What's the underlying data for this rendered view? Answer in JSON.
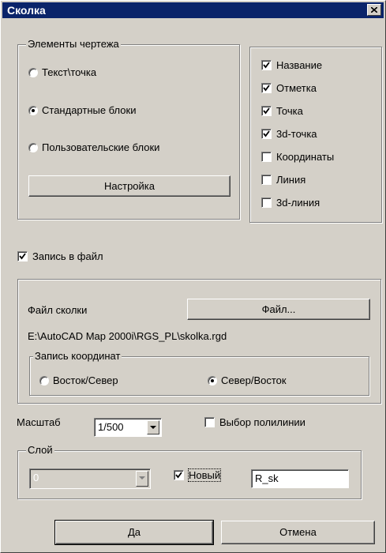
{
  "window": {
    "title": "Сколка"
  },
  "elements_group": {
    "legend": "Элементы чертежа",
    "radios": [
      {
        "label": "Текст\\точка",
        "selected": false
      },
      {
        "label": "Стандартные блоки",
        "selected": true
      },
      {
        "label": "Пользовательские блоки",
        "selected": false
      }
    ],
    "settings_button": "Настройка"
  },
  "attributes": [
    {
      "label": "Название",
      "checked": true
    },
    {
      "label": "Отметка",
      "checked": true
    },
    {
      "label": "Точка",
      "checked": true
    },
    {
      "label": "3d-точка",
      "checked": true
    },
    {
      "label": "Координаты",
      "checked": false
    },
    {
      "label": "Линия",
      "checked": false
    },
    {
      "label": "3d-линия",
      "checked": false
    }
  ],
  "write_to_file": {
    "label": "Запись в файл",
    "checked": true
  },
  "file_group": {
    "file_label": "Файл сколки",
    "file_button": "Файл...",
    "file_path": "E:\\AutoCAD Map 2000i\\RGS_PL\\skolka.rgd",
    "coords_legend": "Запись координат",
    "coord_options": [
      {
        "label": "Восток/Север",
        "selected": false
      },
      {
        "label": "Север/Восток",
        "selected": true
      }
    ]
  },
  "scale": {
    "label": "Масштаб",
    "value": "1/500"
  },
  "polyline": {
    "label": "Выбор полилинии",
    "checked": false
  },
  "layer": {
    "legend": "Слой",
    "value": "0",
    "new_label": "Новый",
    "new_checked": true,
    "name_value": "R_sk"
  },
  "footer": {
    "ok": "Да",
    "cancel": "Отмена"
  }
}
